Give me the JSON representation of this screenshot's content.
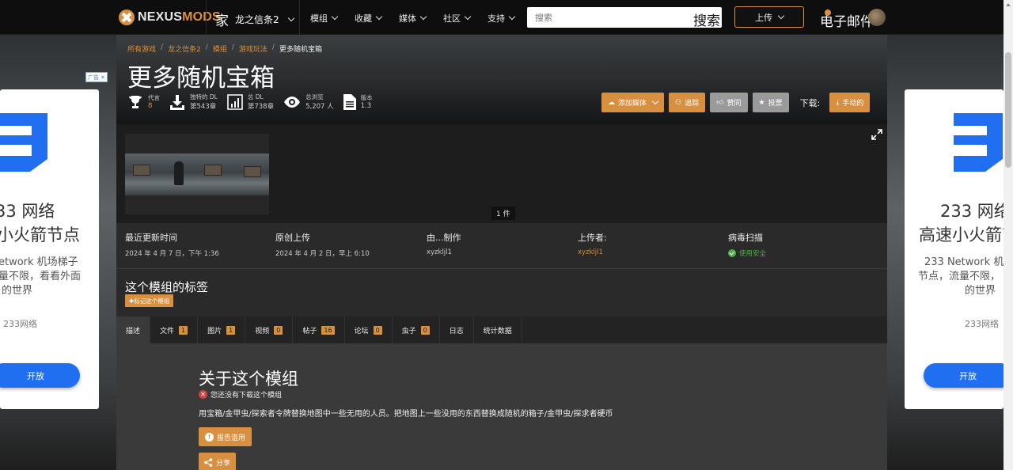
{
  "nav": {
    "logo_a": "NEXUS",
    "logo_b": "MODS",
    "home_glyph": "家",
    "game_name": "龙之信条2",
    "items": [
      "模组",
      "收藏",
      "媒体",
      "社区",
      "支持"
    ],
    "search_placeholder": "搜索",
    "search_button": "搜索",
    "upload": "上传",
    "mail": "电子邮件"
  },
  "breadcrumb": {
    "items": [
      "所有游戏",
      "龙之信条2",
      "模组",
      "游戏玩法"
    ],
    "current": "更多随机宝箱",
    "separator": "/"
  },
  "mod": {
    "title": "更多随机宝箱",
    "stats": {
      "endorsements_label": "代言",
      "endorsements_value": "8",
      "unique_dl_label": "独特的 DL",
      "unique_dl_value": "第543章",
      "total_dl_label": "总 DL",
      "total_dl_value": "第738章",
      "views_label": "总浏览",
      "views_value": "5,207 人",
      "version_label": "版本",
      "version_value": "1.3"
    },
    "actions": {
      "add_media": "添加媒体",
      "track": "追踪",
      "endorse": "赞同",
      "vote": "投票",
      "download_label": "下载:",
      "manual": "手动的"
    }
  },
  "gallery": {
    "count": "1 件"
  },
  "info": {
    "last_updated_label": "最近更新时间",
    "last_updated_value": "2024 年 4 月 7 日，下午 1:36",
    "original_upload_label": "原创上传",
    "original_upload_value": "2024 年 4 月 2 日，早上 6:10",
    "created_by_label": "由...制作",
    "created_by_value": "xyzkljl1",
    "uploaded_by_label": "上传者:",
    "uploaded_by_value": "xyzkljl1",
    "virus_scan_label": "病毒扫描",
    "virus_scan_value": "使用安全"
  },
  "tags": {
    "heading": "这个模组的标签",
    "button": "✚标记这个模组"
  },
  "tabs": [
    {
      "label": "描述",
      "badge": ""
    },
    {
      "label": "文件",
      "badge": "1"
    },
    {
      "label": "图片",
      "badge": "1"
    },
    {
      "label": "视频",
      "badge": "0"
    },
    {
      "label": "帖子",
      "badge": "16"
    },
    {
      "label": "论坛",
      "badge": "0"
    },
    {
      "label": "虫子",
      "badge": "0"
    },
    {
      "label": "日志",
      "badge": ""
    },
    {
      "label": "统计数据",
      "badge": ""
    }
  ],
  "description": {
    "heading": "关于这个模组",
    "not_downloaded": "您还没有下载这个模组",
    "body": "用宝箱/金甲虫/探索者令牌替换地图中一些无用的人员。把地图上一些没用的东西替换成随机的箱子/金甲虫/探求者硬币",
    "report": "报告滥用",
    "share": "分享"
  },
  "ad_left": {
    "badge": "广告",
    "line1": "33 网络",
    "line2": "小火箭节点",
    "line3a": "etwork 机场梯子",
    "line3b": "量不限，看看外面",
    "line3c": "的世界",
    "line4": "233网络",
    "button": "开放"
  },
  "ad_right": {
    "line1": "233 网络",
    "line2": "高速小火箭节",
    "line3a": "233 Network 机",
    "line3b": "节点，流量不限，",
    "line3c": "的世界",
    "line4": "233网络",
    "button": "开放"
  },
  "colors": {
    "accent": "#d98f40",
    "safe": "#4fae48",
    "ad_blue": "#1f6ff0"
  }
}
